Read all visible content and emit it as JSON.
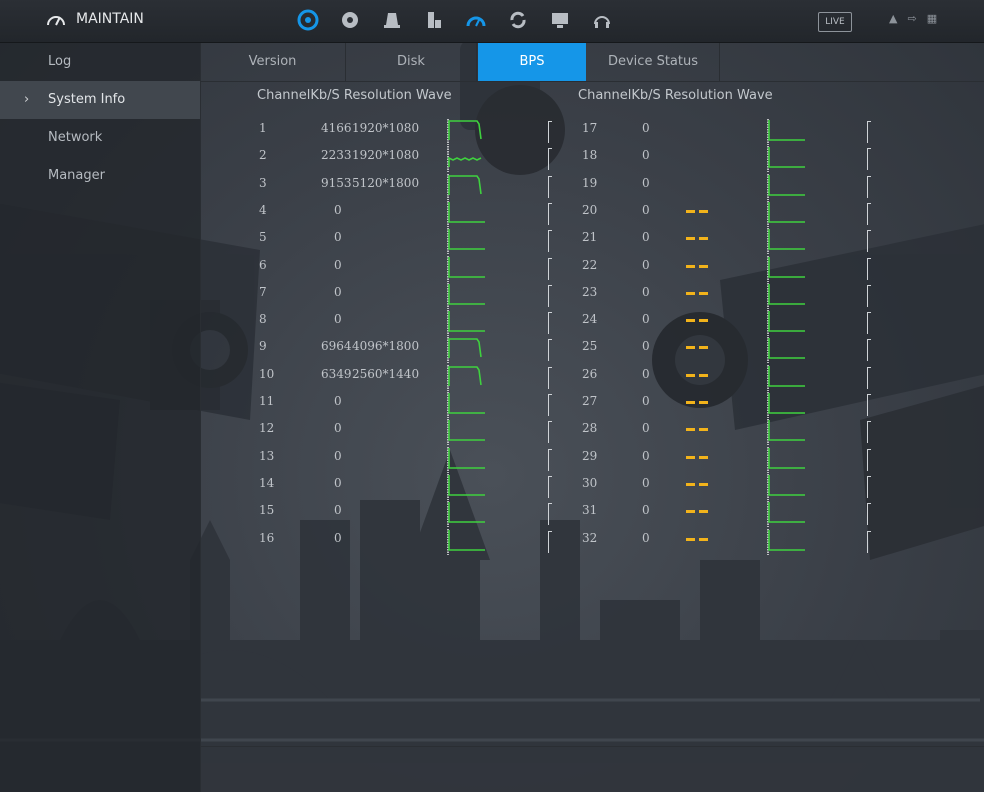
{
  "app": {
    "title": "MAINTAIN"
  },
  "header": {
    "icons": [
      "network-icon",
      "camera-icon",
      "storage-icon",
      "device-icon",
      "maintain-icon",
      "backup-icon",
      "display-icon",
      "audio-icon"
    ],
    "live_label": "LIVE",
    "active_icon_color": "#1596e8"
  },
  "sidebar": {
    "items": [
      {
        "label": "Log",
        "active": false
      },
      {
        "label": "System Info",
        "active": true
      },
      {
        "label": "Network",
        "active": false
      },
      {
        "label": "Manager",
        "active": false
      }
    ]
  },
  "tabs": [
    {
      "label": "Version",
      "active": false
    },
    {
      "label": "Disk",
      "active": false
    },
    {
      "label": "BPS",
      "active": true
    },
    {
      "label": "Device Status",
      "active": false
    }
  ],
  "table": {
    "header_left": "ChannelKb/S Resolution Wave",
    "header_right": "ChannelKb/S Resolution Wave",
    "left_rows": [
      {
        "channel": "1",
        "kbps": "4166",
        "resolution": "1920*1080",
        "wave": "high"
      },
      {
        "channel": "2",
        "kbps": "2233",
        "resolution": "1920*1080",
        "wave": "mid"
      },
      {
        "channel": "3",
        "kbps": "9153",
        "resolution": "5120*1800",
        "wave": "high"
      },
      {
        "channel": "4",
        "kbps": "0",
        "resolution": "",
        "wave": "flat"
      },
      {
        "channel": "5",
        "kbps": "0",
        "resolution": "",
        "wave": "flat"
      },
      {
        "channel": "6",
        "kbps": "0",
        "resolution": "",
        "wave": "flat"
      },
      {
        "channel": "7",
        "kbps": "0",
        "resolution": "",
        "wave": "flat"
      },
      {
        "channel": "8",
        "kbps": "0",
        "resolution": "",
        "wave": "flat"
      },
      {
        "channel": "9",
        "kbps": "6964",
        "resolution": "4096*1800",
        "wave": "high"
      },
      {
        "channel": "10",
        "kbps": "6349",
        "resolution": "2560*1440",
        "wave": "high"
      },
      {
        "channel": "11",
        "kbps": "0",
        "resolution": "",
        "wave": "flat"
      },
      {
        "channel": "12",
        "kbps": "0",
        "resolution": "",
        "wave": "flat"
      },
      {
        "channel": "13",
        "kbps": "0",
        "resolution": "",
        "wave": "flat"
      },
      {
        "channel": "14",
        "kbps": "0",
        "resolution": "",
        "wave": "flat"
      },
      {
        "channel": "15",
        "kbps": "0",
        "resolution": "",
        "wave": "flat"
      },
      {
        "channel": "16",
        "kbps": "0",
        "resolution": "",
        "wave": "flat"
      }
    ],
    "right_rows": [
      {
        "channel": "17",
        "kbps": "0",
        "resolution": "",
        "wave": "flat"
      },
      {
        "channel": "18",
        "kbps": "0",
        "resolution": "",
        "wave": "flat"
      },
      {
        "channel": "19",
        "kbps": "0",
        "resolution": "",
        "wave": "flat"
      },
      {
        "channel": "20",
        "kbps": "0",
        "resolution": "--",
        "wave": "flat"
      },
      {
        "channel": "21",
        "kbps": "0",
        "resolution": "--",
        "wave": "flat"
      },
      {
        "channel": "22",
        "kbps": "0",
        "resolution": "--",
        "wave": "flat"
      },
      {
        "channel": "23",
        "kbps": "0",
        "resolution": "--",
        "wave": "flat"
      },
      {
        "channel": "24",
        "kbps": "0",
        "resolution": "--",
        "wave": "flat"
      },
      {
        "channel": "25",
        "kbps": "0",
        "resolution": "--",
        "wave": "flat"
      },
      {
        "channel": "26",
        "kbps": "0",
        "resolution": "--",
        "wave": "flat"
      },
      {
        "channel": "27",
        "kbps": "0",
        "resolution": "--",
        "wave": "flat"
      },
      {
        "channel": "28",
        "kbps": "0",
        "resolution": "--",
        "wave": "flat"
      },
      {
        "channel": "29",
        "kbps": "0",
        "resolution": "--",
        "wave": "flat"
      },
      {
        "channel": "30",
        "kbps": "0",
        "resolution": "--",
        "wave": "flat"
      },
      {
        "channel": "31",
        "kbps": "0",
        "resolution": "--",
        "wave": "flat"
      },
      {
        "channel": "32",
        "kbps": "0",
        "resolution": "--",
        "wave": "flat"
      }
    ]
  },
  "colors": {
    "accent": "#1596e8",
    "wave": "#3fd13f",
    "dash": "#f2b31b"
  }
}
